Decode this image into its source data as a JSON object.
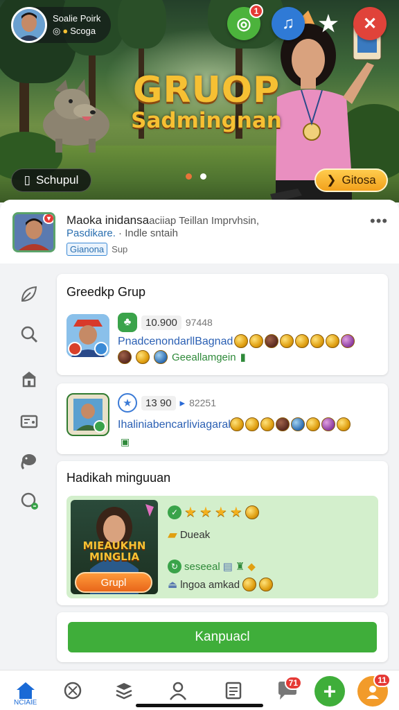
{
  "colors": {
    "accent_green": "#3fae3a",
    "link_blue": "#2a5fb3",
    "gold": "#f6c033",
    "badge_red": "#e53935"
  },
  "hero": {
    "profile_name": "Soalie Poirk",
    "profile_sub": "Scoga",
    "badge_target": "1",
    "title_line1": "GRUOP",
    "title_line2": "Sadmingnan",
    "left_button": "Schupul",
    "right_button": "Gitosa",
    "icons": [
      "target-icon",
      "music-note-icon",
      "star-icon",
      "close-icon"
    ]
  },
  "header": {
    "title": "Maoka inidansa",
    "title_tail": "aciiap Teillan Imprvhsin,",
    "subtitle_link": "Pasdikare.",
    "subtitle_rest": "·  Indle sntaih",
    "tag": "Gianona",
    "tag_rest": "Sup",
    "more": "•••"
  },
  "group_card": {
    "title": "Greedkp Grup",
    "item1": {
      "stat_value": "10.900",
      "stat_extra": "97448",
      "name": "PnadcenondarllBagnad",
      "sub_name": "Geeallamgein"
    },
    "item2": {
      "stat_value": "13 90",
      "stat_extra": "82251",
      "name": "Ihaliniabencarliviagaral"
    }
  },
  "promo_card": {
    "title": "Hadikah minguuan",
    "image_title": "MIEAUKHN MINGLIA",
    "image_button": "Grupl",
    "line2": "Dueak",
    "line3": "seseeal",
    "line4": "lngoa amkad"
  },
  "action": {
    "button": "Kanpuacl"
  },
  "bottom_nav": {
    "home_label": "NCIAIE",
    "chat_badge": "71",
    "profile_badge": "11",
    "icons": [
      "home-icon",
      "compass-icon",
      "layers-icon",
      "person-icon",
      "document-icon",
      "chat-icon",
      "add-icon",
      "profile-icon"
    ]
  },
  "side_rail": {
    "icons": [
      "leaf-icon",
      "search-icon",
      "store-icon",
      "ticket-icon",
      "elephant-icon",
      "clock-icon"
    ]
  }
}
